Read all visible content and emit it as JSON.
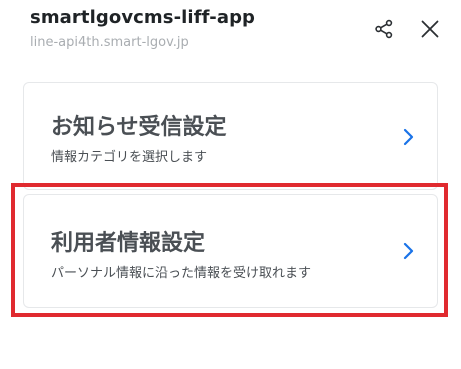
{
  "header": {
    "title": "smartlgovcms-liff-app",
    "url": "line-api4th.smart-lgov.jp",
    "share_icon": "share-icon",
    "close_icon": "close-icon"
  },
  "cards": [
    {
      "title": "お知らせ受信設定",
      "subtitle": "情報カテゴリを選択します",
      "icon": "chevron-right-icon"
    },
    {
      "title": "利用者情報設定",
      "subtitle": "パーソナル情報に沿った情報を受け取れます",
      "icon": "chevron-right-icon"
    }
  ],
  "colors": {
    "accent": "#1a73e8",
    "highlight": "#e02a2f",
    "text": "#4a4f54",
    "muted": "#a9adb1"
  }
}
